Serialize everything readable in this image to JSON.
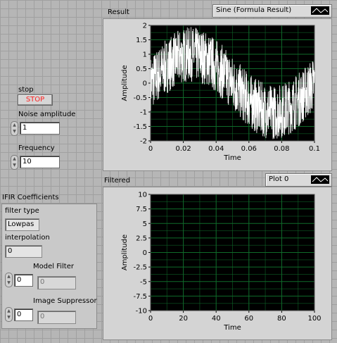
{
  "controls": {
    "stop": {
      "label": "stop",
      "button_text": "STOP"
    },
    "noise_amplitude": {
      "label": "Noise amplitude",
      "value": "1"
    },
    "frequency": {
      "label": "Frequency",
      "value": "10"
    }
  },
  "ifir": {
    "title": "IFIR Coefficients",
    "filter_type": {
      "label": "filter type",
      "value": "Lowpas"
    },
    "interpolation": {
      "label": "interpolation",
      "value": "0"
    },
    "model_filter": {
      "label": "Model Filter",
      "index": "0",
      "value": "0"
    },
    "image_suppressor": {
      "label": "Image Suppressor",
      "index": "0",
      "value": "0"
    }
  },
  "graphs": {
    "result": {
      "label": "Result",
      "legend": "Sine (Formula Result)",
      "xlabel": "Time",
      "ylabel": "Amplitude"
    },
    "filtered": {
      "label": "Filtered",
      "legend": "Plot 0",
      "xlabel": "Time",
      "ylabel": "Amplitude"
    }
  },
  "chart_data": [
    {
      "type": "line",
      "title": "Result",
      "xlabel": "Time",
      "ylabel": "Amplitude",
      "xlim": [
        0,
        0.1
      ],
      "ylim": [
        -2,
        2
      ],
      "x_ticks": [
        "0",
        "0.02",
        "0.04",
        "0.06",
        "0.08",
        "0.1"
      ],
      "y_ticks": [
        "2",
        "1.5",
        "1",
        "0.5",
        "0",
        "-0.5",
        "-1",
        "-1.5",
        "-2"
      ],
      "grid": true,
      "background": "#000000",
      "series": [
        {
          "name": "Sine (Formula Result)",
          "color": "#ffffff",
          "description_values": {
            "sine_amplitude": 1,
            "sine_frequency": 10,
            "noise_amplitude": 1
          }
        }
      ]
    },
    {
      "type": "line",
      "title": "Filtered",
      "xlabel": "Time",
      "ylabel": "Amplitude",
      "xlim": [
        0,
        100
      ],
      "ylim": [
        -10,
        10
      ],
      "x_ticks": [
        "0",
        "20",
        "40",
        "60",
        "80",
        "100"
      ],
      "y_ticks": [
        "10",
        "7.5",
        "5",
        "2.5",
        "0",
        "-2.5",
        "-5",
        "-7.5",
        "-10"
      ],
      "grid": true,
      "background": "#000000",
      "series": [
        {
          "name": "Plot 0",
          "values": []
        }
      ]
    }
  ],
  "colors": {
    "plot_bg": "#000000",
    "grid": "#0f6b2a",
    "trace": "#ffffff",
    "stop_text": "#ff2020"
  }
}
